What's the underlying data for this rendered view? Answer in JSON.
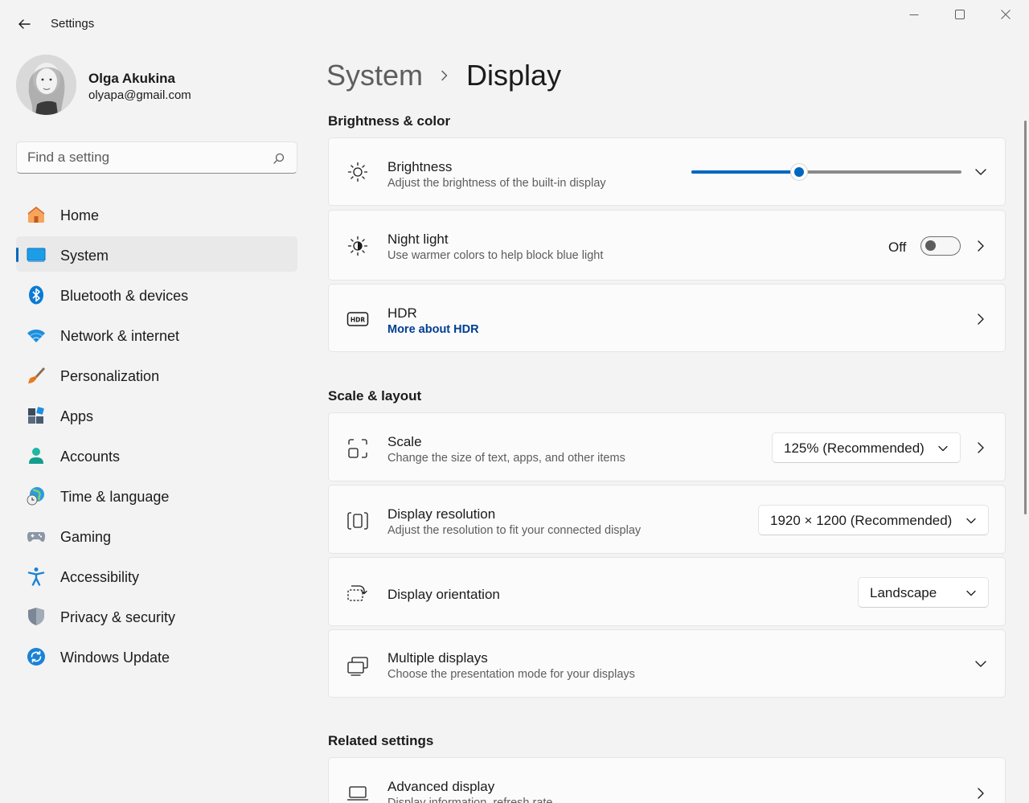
{
  "window": {
    "title": "Settings"
  },
  "profile": {
    "name": "Olga Akukina",
    "email": "olyapa@gmail.com"
  },
  "search": {
    "placeholder": "Find a setting"
  },
  "sidebar": {
    "items": [
      {
        "label": "Home",
        "icon": "home-icon",
        "active": false
      },
      {
        "label": "System",
        "icon": "system-icon",
        "active": true
      },
      {
        "label": "Bluetooth & devices",
        "icon": "bluetooth-icon",
        "active": false
      },
      {
        "label": "Network & internet",
        "icon": "wifi-icon",
        "active": false
      },
      {
        "label": "Personalization",
        "icon": "brush-icon",
        "active": false
      },
      {
        "label": "Apps",
        "icon": "apps-icon",
        "active": false
      },
      {
        "label": "Accounts",
        "icon": "person-icon",
        "active": false
      },
      {
        "label": "Time & language",
        "icon": "globe-clock-icon",
        "active": false
      },
      {
        "label": "Gaming",
        "icon": "gamepad-icon",
        "active": false
      },
      {
        "label": "Accessibility",
        "icon": "accessibility-icon",
        "active": false
      },
      {
        "label": "Privacy & security",
        "icon": "shield-icon",
        "active": false
      },
      {
        "label": "Windows Update",
        "icon": "update-icon",
        "active": false
      }
    ]
  },
  "breadcrumb": {
    "parent": "System",
    "current": "Display"
  },
  "sections": {
    "brightness_color": "Brightness & color",
    "scale_layout": "Scale & layout",
    "related": "Related settings"
  },
  "brightness": {
    "title": "Brightness",
    "subtitle": "Adjust the brightness of the built-in display",
    "level": 0.4
  },
  "night_light": {
    "title": "Night light",
    "subtitle": "Use warmer colors to help block blue light",
    "state_label": "Off"
  },
  "hdr": {
    "title": "HDR",
    "link": "More about HDR"
  },
  "scale": {
    "title": "Scale",
    "subtitle": "Change the size of text, apps, and other items",
    "value": "125% (Recommended)"
  },
  "resolution": {
    "title": "Display resolution",
    "subtitle": "Adjust the resolution to fit your connected display",
    "value": "1920 × 1200 (Recommended)"
  },
  "orientation": {
    "title": "Display orientation",
    "value": "Landscape"
  },
  "multiple_displays": {
    "title": "Multiple displays",
    "subtitle": "Choose the presentation mode for your displays"
  },
  "advanced_display": {
    "title": "Advanced display",
    "subtitle": "Display information, refresh rate"
  },
  "colors": {
    "accent": "#0067c0",
    "link": "#003e92",
    "background": "#f3f3f3",
    "card": "#fbfbfb"
  }
}
